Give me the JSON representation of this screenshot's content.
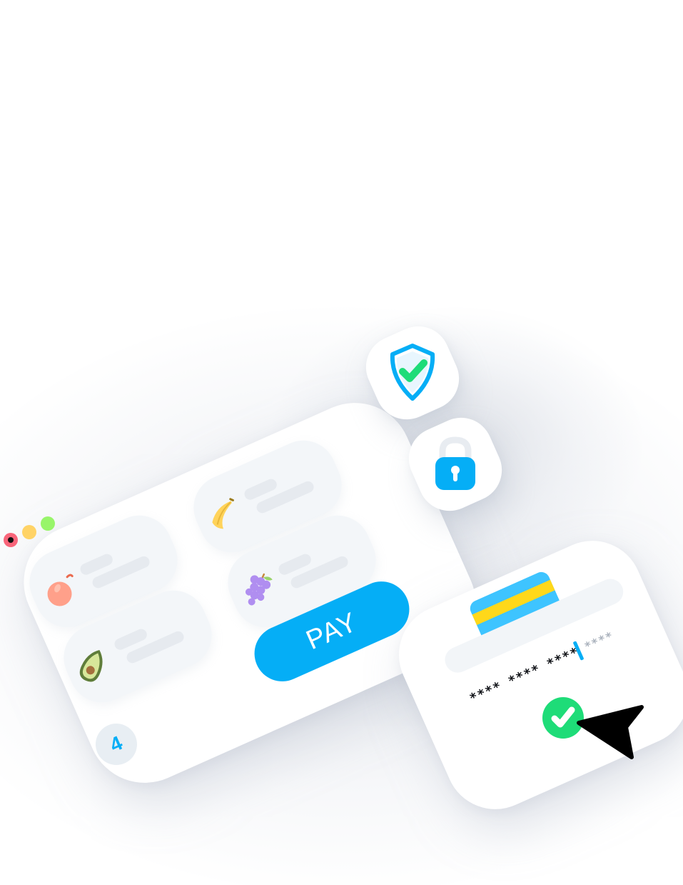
{
  "store": {
    "window_controls": [
      "close-dot",
      "minimize-dot",
      "maximize-dot"
    ],
    "products": [
      {
        "icon": "apple-icon"
      },
      {
        "icon": "banana-icon"
      },
      {
        "icon": "avocado-icon"
      },
      {
        "icon": "grapes-icon"
      }
    ],
    "pay_label": "PAY",
    "cart_count": "4"
  },
  "security": {
    "shield_icon": "shield-check-icon",
    "lock_icon": "padlock-icon"
  },
  "checkout": {
    "card_icon": "credit-card-icon",
    "card_number_entered": "**** **** ****",
    "card_number_placeholder": "****",
    "confirm_icon": "checkmark-icon",
    "pointer_icon": "cursor-arrow-icon"
  },
  "colors": {
    "accent": "#05aef6",
    "success": "#1edc78",
    "dot_red": "#f8657a",
    "dot_yellow": "#ffd366",
    "dot_green": "#98f56a",
    "card_stripe": "#ffd81a"
  }
}
